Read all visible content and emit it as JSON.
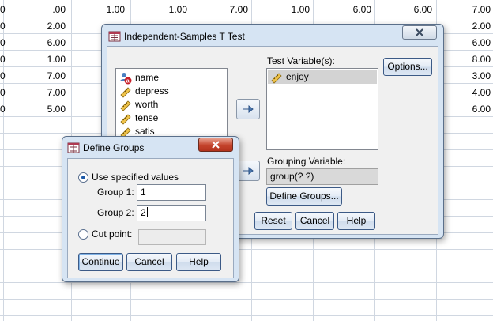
{
  "sheet": {
    "rows": [
      [
        ".00",
        "1.00",
        "1.00",
        "7.00",
        "1.00",
        "6.00",
        "6.00",
        "7.00"
      ],
      [
        "2.00",
        "",
        "",
        "",
        "",
        "",
        "",
        "2.00"
      ],
      [
        "6.00",
        "",
        "",
        "",
        "",
        "",
        "",
        "6.00"
      ],
      [
        "1.00",
        "",
        "",
        "",
        "",
        "",
        "",
        "8.00"
      ],
      [
        "7.00",
        "",
        "",
        "",
        "",
        "",
        "",
        "3.00"
      ],
      [
        "7.00",
        "",
        "",
        "",
        "",
        "",
        "",
        "4.00"
      ],
      [
        "5.00",
        "",
        "",
        "",
        "",
        "",
        "",
        "6.00"
      ]
    ],
    "left_edge": [
      "0",
      "0",
      "0",
      "0",
      "0",
      "0",
      "0"
    ]
  },
  "ttest": {
    "title": "Independent-Samples T Test",
    "variables": [
      {
        "name": "name",
        "icon": "nominal-variable-icon"
      },
      {
        "name": "depress",
        "icon": "scale-variable-icon"
      },
      {
        "name": "worth",
        "icon": "scale-variable-icon"
      },
      {
        "name": "tense",
        "icon": "scale-variable-icon"
      },
      {
        "name": "satis",
        "icon": "scale-variable-icon"
      }
    ],
    "test_variables_label": "Test Variable(s):",
    "test_variables": [
      {
        "name": "enjoy",
        "icon": "scale-variable-icon"
      }
    ],
    "grouping_variable_label": "Grouping Variable:",
    "grouping_variable_value": "group(? ?)",
    "options_label": "Options...",
    "define_groups_label": "Define Groups...",
    "reset_label": "Reset",
    "cancel_label": "Cancel",
    "help_label": "Help"
  },
  "define_groups": {
    "title": "Define Groups",
    "use_specified_label": "Use specified values",
    "group1_label": "Group 1:",
    "group1_value": "1",
    "group2_label": "Group 2:",
    "group2_value": "2",
    "cut_point_label": "Cut point:",
    "cut_point_value": "",
    "continue_label": "Continue",
    "cancel_label": "Cancel",
    "help_label": "Help"
  }
}
